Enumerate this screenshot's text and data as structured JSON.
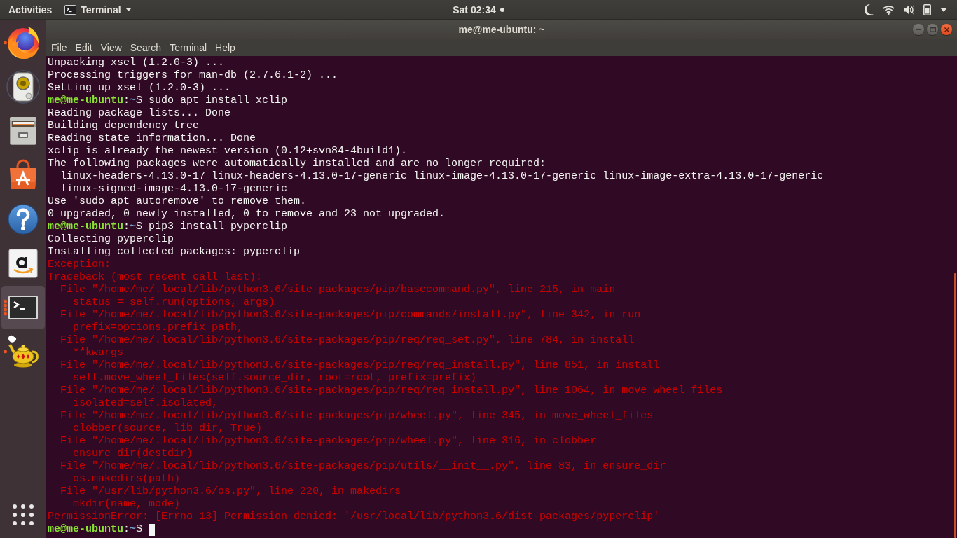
{
  "top_bar": {
    "activities": "Activities",
    "app_menu": "Terminal",
    "clock": "Sat 02:34",
    "notification": true
  },
  "dock": {
    "items": [
      {
        "kind": "browser",
        "running": true,
        "multi_window": false,
        "selected": false
      },
      {
        "kind": "music",
        "running": false,
        "multi_window": false,
        "selected": false
      },
      {
        "kind": "files",
        "running": false,
        "multi_window": false,
        "selected": false
      },
      {
        "kind": "software",
        "running": false,
        "multi_window": false,
        "selected": false
      },
      {
        "kind": "help",
        "running": false,
        "multi_window": false,
        "selected": false
      },
      {
        "kind": "store",
        "running": false,
        "multi_window": false,
        "selected": false
      },
      {
        "kind": "terminal",
        "running": true,
        "multi_window": true,
        "selected": true
      },
      {
        "kind": "teapot",
        "running": true,
        "multi_window": false,
        "selected": false
      }
    ]
  },
  "window": {
    "title": "me@me-ubuntu: ~",
    "menu": [
      "File",
      "Edit",
      "View",
      "Search",
      "Terminal",
      "Help"
    ]
  },
  "terminal": {
    "lines": [
      {
        "kind": "output",
        "text": "Unpacking xsel (1.2.0-3) ..."
      },
      {
        "kind": "output",
        "text": "Processing triggers for man-db (2.7.6.1-2) ..."
      },
      {
        "kind": "output",
        "text": "Setting up xsel (1.2.0-3) ..."
      },
      {
        "kind": "prompt",
        "user": "me@me-ubuntu",
        "separator": ":",
        "path": "~",
        "sign": "$",
        "command": "sudo apt install xclip"
      },
      {
        "kind": "output",
        "text": "Reading package lists... Done"
      },
      {
        "kind": "output",
        "text": "Building dependency tree"
      },
      {
        "kind": "output",
        "text": "Reading state information... Done"
      },
      {
        "kind": "output",
        "text": "xclip is already the newest version (0.12+svn84-4build1)."
      },
      {
        "kind": "output",
        "text": "The following packages were automatically installed and are no longer required:"
      },
      {
        "kind": "output",
        "text": "  linux-headers-4.13.0-17 linux-headers-4.13.0-17-generic linux-image-4.13.0-17-generic linux-image-extra-4.13.0-17-generic"
      },
      {
        "kind": "output",
        "text": "  linux-signed-image-4.13.0-17-generic"
      },
      {
        "kind": "output",
        "text": "Use 'sudo apt autoremove' to remove them."
      },
      {
        "kind": "output",
        "text": "0 upgraded, 0 newly installed, 0 to remove and 23 not upgraded."
      },
      {
        "kind": "prompt",
        "user": "me@me-ubuntu",
        "separator": ":",
        "path": "~",
        "sign": "$",
        "command": "pip3 install pyperclip"
      },
      {
        "kind": "output",
        "text": "Collecting pyperclip"
      },
      {
        "kind": "output",
        "text": "Installing collected packages: pyperclip"
      },
      {
        "kind": "error",
        "text": "Exception:"
      },
      {
        "kind": "error",
        "text": "Traceback (most recent call last):"
      },
      {
        "kind": "error",
        "text": "  File \"/home/me/.local/lib/python3.6/site-packages/pip/basecommand.py\", line 215, in main"
      },
      {
        "kind": "error",
        "text": "    status = self.run(options, args)"
      },
      {
        "kind": "error",
        "text": "  File \"/home/me/.local/lib/python3.6/site-packages/pip/commands/install.py\", line 342, in run"
      },
      {
        "kind": "error",
        "text": "    prefix=options.prefix_path,"
      },
      {
        "kind": "error",
        "text": "  File \"/home/me/.local/lib/python3.6/site-packages/pip/req/req_set.py\", line 784, in install"
      },
      {
        "kind": "error",
        "text": "    **kwargs"
      },
      {
        "kind": "error",
        "text": "  File \"/home/me/.local/lib/python3.6/site-packages/pip/req/req_install.py\", line 851, in install"
      },
      {
        "kind": "error",
        "text": "    self.move_wheel_files(self.source_dir, root=root, prefix=prefix)"
      },
      {
        "kind": "error",
        "text": "  File \"/home/me/.local/lib/python3.6/site-packages/pip/req/req_install.py\", line 1064, in move_wheel_files"
      },
      {
        "kind": "error",
        "text": "    isolated=self.isolated,"
      },
      {
        "kind": "error",
        "text": "  File \"/home/me/.local/lib/python3.6/site-packages/pip/wheel.py\", line 345, in move_wheel_files"
      },
      {
        "kind": "error",
        "text": "    clobber(source, lib_dir, True)"
      },
      {
        "kind": "error",
        "text": "  File \"/home/me/.local/lib/python3.6/site-packages/pip/wheel.py\", line 316, in clobber"
      },
      {
        "kind": "error",
        "text": "    ensure_dir(destdir)"
      },
      {
        "kind": "error",
        "text": "  File \"/home/me/.local/lib/python3.6/site-packages/pip/utils/__init__.py\", line 83, in ensure_dir"
      },
      {
        "kind": "error",
        "text": "    os.makedirs(path)"
      },
      {
        "kind": "error",
        "text": "  File \"/usr/lib/python3.6/os.py\", line 220, in makedirs"
      },
      {
        "kind": "error",
        "text": "    mkdir(name, mode)"
      },
      {
        "kind": "error",
        "text": "PermissionError: [Errno 13] Permission denied: '/usr/local/lib/python3.6/dist-packages/pyperclip'"
      },
      {
        "kind": "prompt",
        "user": "me@me-ubuntu",
        "separator": ":",
        "path": "~",
        "sign": "$"
      }
    ],
    "cursor": true
  }
}
